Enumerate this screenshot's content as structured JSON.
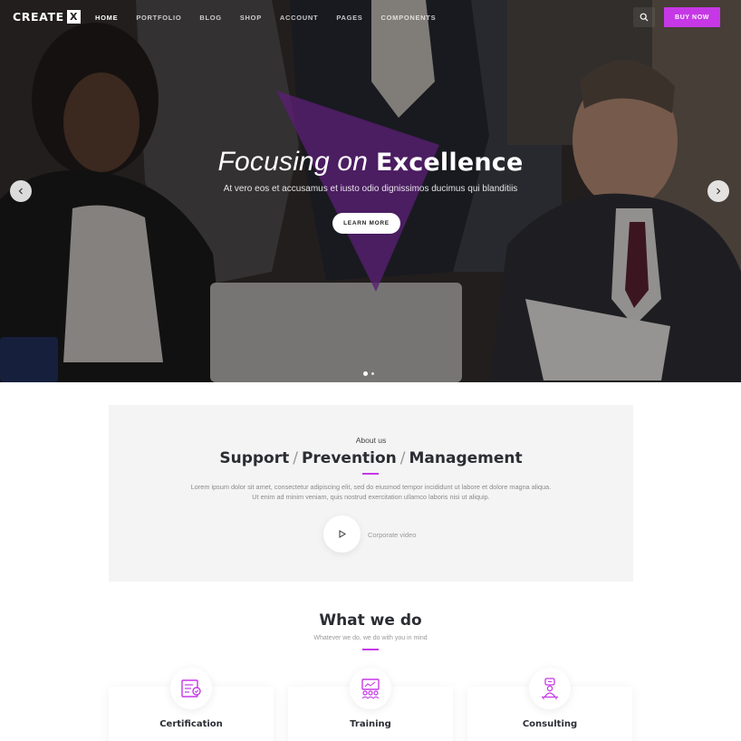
{
  "nav": {
    "logo_text": "CREATE",
    "logo_mark": "X",
    "items": [
      {
        "label": "HOME",
        "active": true
      },
      {
        "label": "PORTFOLIO",
        "active": false
      },
      {
        "label": "BLOG",
        "active": false
      },
      {
        "label": "SHOP",
        "active": false
      },
      {
        "label": "ACCOUNT",
        "active": false
      },
      {
        "label": "PAGES",
        "active": false
      },
      {
        "label": "COMPONENTS",
        "active": false
      }
    ],
    "search_icon": "search-icon",
    "buy_label": "BUY NOW"
  },
  "hero": {
    "headline_light": "Focusing on",
    "headline_bold": "Excellence",
    "subline": "At vero eos et accusamus et iusto odio dignissimos ducimus qui blanditiis",
    "cta_label": "LEARN MORE",
    "prev_icon": "chevron-left-icon",
    "next_icon": "chevron-right-icon",
    "slide_count": 2,
    "active_slide": 1
  },
  "about": {
    "label": "About us",
    "title_parts": [
      "Support",
      "Prevention",
      "Management"
    ],
    "separator": "/",
    "text": "Lorem ipsum dolor sit amet, consectetur adipiscing elit, sed do eiusmod tempor incididunt ut labore et dolore magna aliqua. Ut enim ad minim veniam, quis nostrud exercitation ullamco laboris nisi ut aliquip.",
    "video_label": "Corporate video",
    "play_icon": "play-icon"
  },
  "services": {
    "title": "What we do",
    "subtitle": "Whatever we do, we do with you in mind",
    "items": [
      {
        "label": "Certification",
        "icon": "certificate-icon"
      },
      {
        "label": "Training",
        "icon": "training-icon"
      },
      {
        "label": "Consulting",
        "icon": "consulting-icon"
      }
    ]
  },
  "colors": {
    "accent": "#c638e6",
    "dark_text": "#2b2d33",
    "section_bg": "#f4f4f4"
  }
}
